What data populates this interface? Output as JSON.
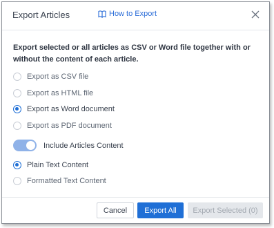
{
  "dialog": {
    "title": "Export Articles",
    "help_link_label": "How to Export",
    "description": "Export selected or all articles as CSV or Word file together with or without the content of each article."
  },
  "format_options": [
    {
      "label": "Export as CSV file",
      "checked": false
    },
    {
      "label": "Export as HTML file",
      "checked": false
    },
    {
      "label": "Export as Word document",
      "checked": true
    },
    {
      "label": "Export as PDF document",
      "checked": false
    }
  ],
  "include_content": {
    "label": "Include Articles Content",
    "enabled": true
  },
  "content_options": [
    {
      "label": "Plain Text Content",
      "checked": true
    },
    {
      "label": "Formatted Text Content",
      "checked": false
    }
  ],
  "footer": {
    "cancel_label": "Cancel",
    "export_all_label": "Export All",
    "export_selected_label": "Export Selected (0)"
  },
  "colors": {
    "accent": "#1f6fd6",
    "toggle_on": "#8fb2e8",
    "disabled_button": "#e4e7eb"
  },
  "icons": {
    "help": "book-icon",
    "close": "close-icon"
  }
}
